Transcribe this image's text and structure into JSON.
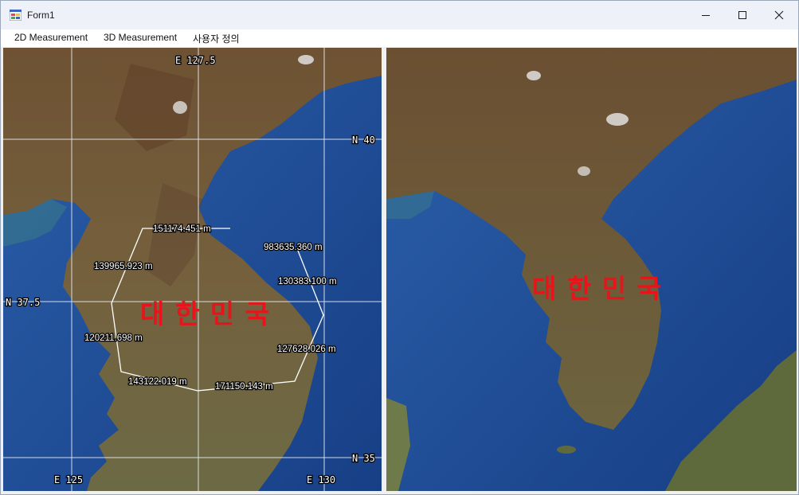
{
  "window": {
    "title": "Form1"
  },
  "menu": {
    "items": [
      "2D Measurement",
      "3D Measurement",
      "사용자 정의"
    ]
  },
  "left_map": {
    "grid_labels": [
      "E 127.5",
      "N 40",
      "N 37.5",
      "N 35",
      "E 125",
      "E 130"
    ],
    "country_label": "대 한 민 국",
    "measurements": [
      "151174.451 m",
      "983635.360 m",
      "139965.923 m",
      "130383.100 m",
      "120211.698 m",
      "127628.026 m",
      "143122.019 m",
      "171150.143 m"
    ]
  },
  "right_map": {
    "country_label": "대 한 민 국"
  },
  "colors": {
    "ocean": "#1f4f9a",
    "land": "#6b5a3a",
    "grid": "#e6ecf2",
    "label": "#e8141b"
  }
}
